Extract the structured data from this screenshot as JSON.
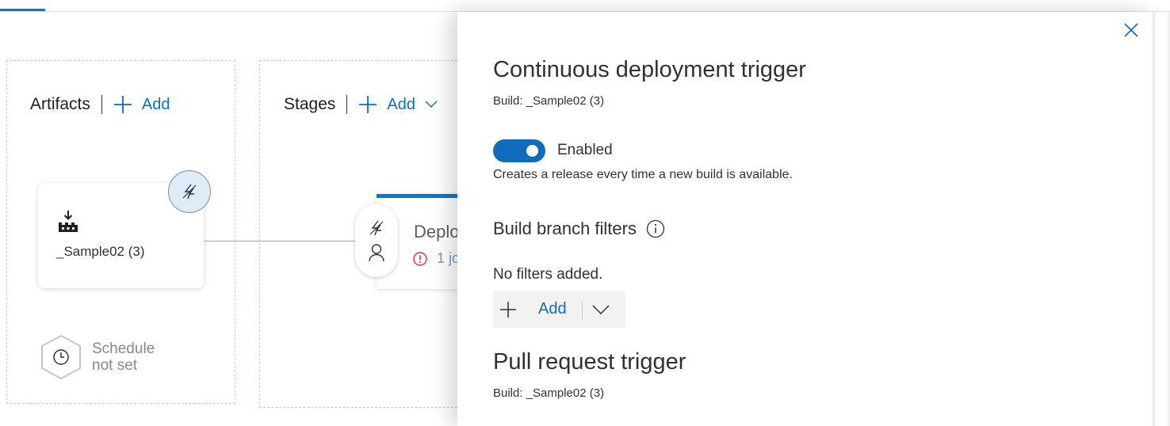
{
  "artifacts": {
    "title": "Artifacts",
    "add_label": "Add",
    "card_name": "_Sample02 (3)",
    "schedule_line1": "Schedule",
    "schedule_line2": "not set"
  },
  "stages": {
    "title": "Stages",
    "add_label": "Add",
    "stage_name": "Deplo",
    "stage_jobs": "1 jo"
  },
  "panel": {
    "title": "Continuous deployment trigger",
    "subtitle": "Build: _Sample02 (3)",
    "toggle_state": "on",
    "toggle_label": "Enabled",
    "toggle_description": "Creates a release every time a new build is available.",
    "branch_filters_heading": "Build branch filters",
    "no_filters_text": "No filters added.",
    "add_label": "Add",
    "pr_title": "Pull request trigger",
    "pr_subtitle": "Build: _Sample02 (3)"
  },
  "colors": {
    "accent": "#0078d4",
    "link": "#106ebe",
    "toggle_on": "#0f6cbd",
    "badge_bg": "#deecf9",
    "error": "#d13438"
  },
  "icons": [
    "plus-icon",
    "chevron-down-icon",
    "lightning-icon",
    "build-icon",
    "clock-icon",
    "person-icon",
    "error-icon",
    "info-icon",
    "close-icon"
  ]
}
